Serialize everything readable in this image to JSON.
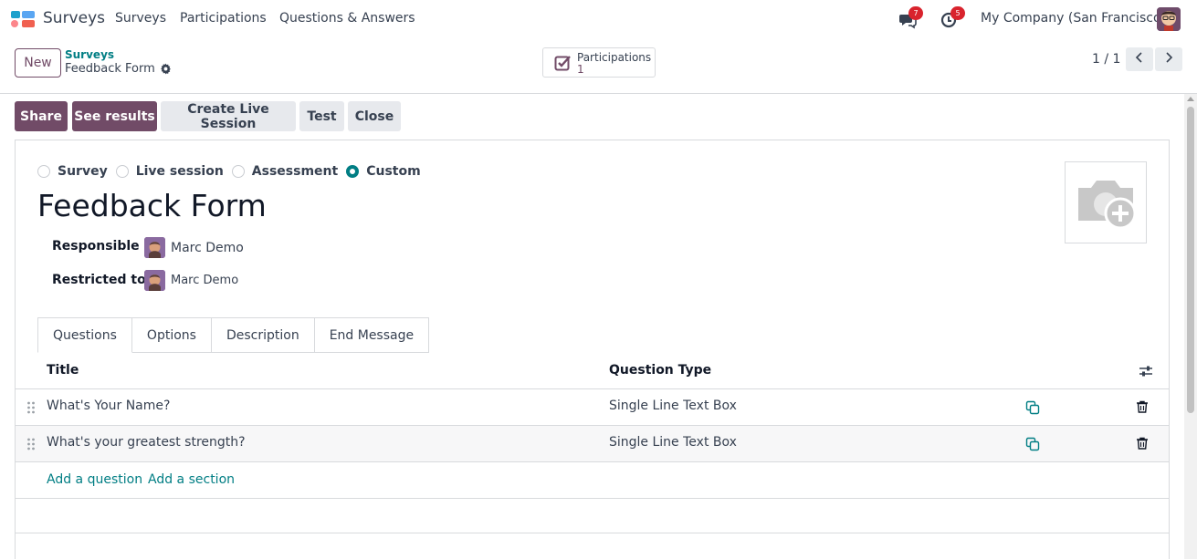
{
  "app": {
    "name": "Surveys"
  },
  "nav": {
    "menu": [
      "Surveys",
      "Participations",
      "Questions & Answers"
    ],
    "messages_count": "7",
    "activities_count": "5",
    "company": "My Company (San Francisco)"
  },
  "control": {
    "new_label": "New",
    "breadcrumb_parent": "Surveys",
    "breadcrumb_current": "Feedback Form",
    "smart_button_label": "Participations",
    "smart_button_value": "1",
    "pager": "1 / 1"
  },
  "actions": {
    "share": "Share",
    "see_results": "See results",
    "create_live": "Create Live Session",
    "test": "Test",
    "close": "Close"
  },
  "form": {
    "survey_types": [
      {
        "label": "Survey",
        "selected": false
      },
      {
        "label": "Live session",
        "selected": false
      },
      {
        "label": "Assessment",
        "selected": false
      },
      {
        "label": "Custom",
        "selected": true
      }
    ],
    "title": "Feedback Form",
    "responsible_label": "Responsible",
    "responsible_value": "Marc Demo",
    "restricted_label": "Restricted to",
    "restricted_value": "Marc Demo"
  },
  "tabs": [
    "Questions",
    "Options",
    "Description",
    "End Message"
  ],
  "table": {
    "headers": [
      "Title",
      "Question Type"
    ],
    "rows": [
      {
        "title": "What's Your Name?",
        "type": "Single Line Text Box"
      },
      {
        "title": "What's your greatest strength?",
        "type": "Single Line Text Box"
      }
    ],
    "add_question": "Add a question",
    "add_section": "Add a section"
  },
  "colors": {
    "brand": "#714b67",
    "accent": "#017e84",
    "badge": "#d9232d"
  }
}
